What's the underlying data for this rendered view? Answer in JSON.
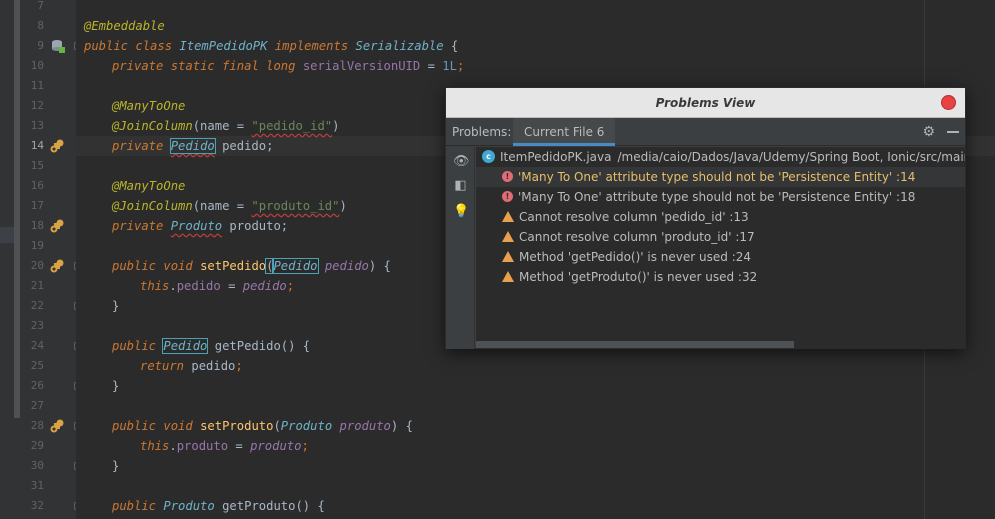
{
  "editor": {
    "line_numbers": [
      "7",
      "8",
      "9",
      "10",
      "11",
      "12",
      "13",
      "14",
      "15",
      "16",
      "17",
      "18",
      "19",
      "20",
      "21",
      "22",
      "23",
      "24",
      "25",
      "26",
      "27",
      "28",
      "29",
      "30",
      "31",
      "32"
    ],
    "code": {
      "l8_annotation": "@Embeddable",
      "l9_public": "public",
      "l9_class": "class",
      "l9_name": "ItemPedidoPK",
      "l9_implements": "implements",
      "l9_iface": "Serializable",
      "l9_brace": " {",
      "l10_private": "private",
      "l10_static": "static",
      "l10_final": "final",
      "l10_long": "long",
      "l10_field": "serialVersionUID",
      "l10_eq": " = ",
      "l10_num": "1L",
      "l10_semi": ";",
      "l12_annotation": "@ManyToOne",
      "l13_annotation": "@JoinColumn",
      "l13_paren_open": "(name = ",
      "l13_str": "\"pedido_id\"",
      "l13_paren_close": ")",
      "l14_private": "private",
      "l14_type": "Pedido",
      "l14_rest": " pedido;",
      "l16_annotation": "@ManyToOne",
      "l17_annotation": "@JoinColumn",
      "l17_paren_open": "(name = ",
      "l17_str": "\"produto_id\"",
      "l17_paren_close": ")",
      "l18_private": "private",
      "l18_type": "Produto",
      "l18_rest": " produto;",
      "l20_public": "public",
      "l20_void": "void",
      "l20_fn": "setPedido",
      "l20_open": "(",
      "l20_type": "Pedido",
      "l20_param": "pedido",
      "l20_close": ") {",
      "l21_this": "this",
      "l21_dot": ".",
      "l21_field": "pedido",
      "l21_eq": " = ",
      "l21_param": "pedido",
      "l21_semi": ";",
      "l22_close": "}",
      "l24_public": "public",
      "l24_type": "Pedido",
      "l24_fn": "getPedido",
      "l24_rest": "() {",
      "l25_return": "return",
      "l25_field": "pedido",
      "l25_semi": ";",
      "l26_close": "}",
      "l28_public": "public",
      "l28_void": "void",
      "l28_fn": "setProduto",
      "l28_open": "(",
      "l28_type": "Produto",
      "l28_param": "produto",
      "l28_close": ") {",
      "l29_this": "this",
      "l29_dot": ".",
      "l29_field": "produto",
      "l29_eq": " = ",
      "l29_param": "produto",
      "l29_semi": ";",
      "l30_close": "}",
      "l32_public": "public",
      "l32_type": "Produto",
      "l32_fn": "getProduto",
      "l32_rest": "() {"
    }
  },
  "problems_view": {
    "title": "Problems View",
    "problems_label": "Problems:",
    "active_tab": "Current File 6",
    "file": {
      "name": "ItemPedidoPK.java",
      "path": "/media/caio/Dados/Java/Udemy/Spring Boot, Ionic/src/main/java/"
    },
    "items": [
      {
        "severity": "error",
        "message": "'Many To One' attribute type should not be 'Persistence Entity' :14"
      },
      {
        "severity": "error",
        "message": "'Many To One' attribute type should not be 'Persistence Entity' :18"
      },
      {
        "severity": "warning",
        "message": "Cannot resolve column 'pedido_id' :13"
      },
      {
        "severity": "warning",
        "message": "Cannot resolve column 'produto_id' :17"
      },
      {
        "severity": "warning",
        "message": "Method 'getPedido()' is never used :24"
      },
      {
        "severity": "warning",
        "message": "Method 'getProduto()' is never used :32"
      }
    ]
  },
  "colors": {
    "editor_bg": "#2b2b2b",
    "keyword": "#cc7832",
    "annotation": "#bbb529",
    "string": "#6a8759",
    "error": "#e06c75",
    "warning": "#e8a050",
    "selected_message": "#e8bf6a",
    "tab_underline": "#4a88c7"
  },
  "icons": [
    "database-icon",
    "error-bulb-icon",
    "override-icon",
    "eye-icon",
    "layout-icon",
    "bulb-icon",
    "gear-icon",
    "minimize-icon",
    "close-icon",
    "java-class-icon",
    "error-icon",
    "warning-icon"
  ]
}
